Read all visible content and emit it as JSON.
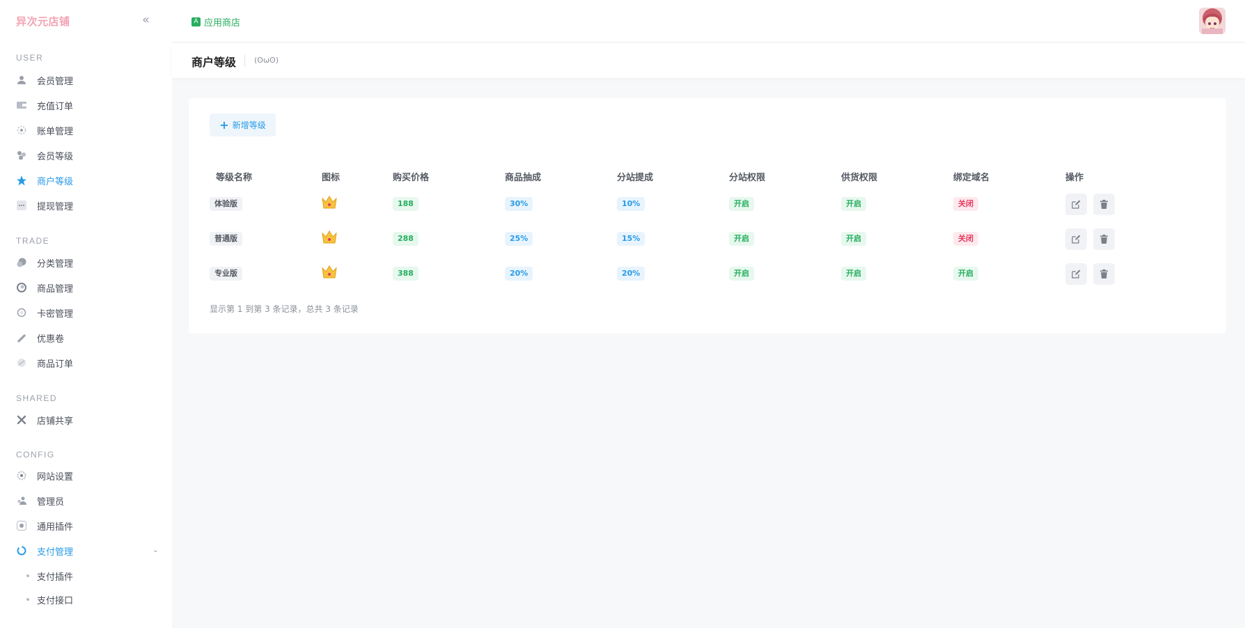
{
  "brand": "异次元店铺",
  "topbar": {
    "crumb": "应用商店"
  },
  "sidebar": {
    "sections": [
      "USER",
      "TRADE",
      "SHARED",
      "CONFIG"
    ],
    "user_items": [
      "会员管理",
      "充值订单",
      "账单管理",
      "会员等级",
      "商户等级",
      "提现管理"
    ],
    "trade_items": [
      "分类管理",
      "商品管理",
      "卡密管理",
      "优惠卷",
      "商品订单"
    ],
    "shared_items": [
      "店铺共享"
    ],
    "config_items": [
      "网站设置",
      "管理员",
      "通用插件",
      "支付管理"
    ],
    "pay_sub_items": [
      "支付插件",
      "支付接口"
    ],
    "active_item": "商户等级"
  },
  "page": {
    "title": "商户等级",
    "face": "(ʘωʘ)"
  },
  "toolbar": {
    "add_label": "新增等级"
  },
  "table": {
    "headers": [
      "等级名称",
      "图标",
      "购买价格",
      "商品抽成",
      "分站提成",
      "分站权限",
      "供货权限",
      "绑定域名",
      "操作"
    ],
    "rows": [
      {
        "name": "体验版",
        "price": "188",
        "commission": "30%",
        "substation": "10%",
        "sub_perm": "开启",
        "supply_perm": "开启",
        "domain_perm": "关闭"
      },
      {
        "name": "普通版",
        "price": "288",
        "commission": "25%",
        "substation": "15%",
        "sub_perm": "开启",
        "supply_perm": "开启",
        "domain_perm": "关闭"
      },
      {
        "name": "专业版",
        "price": "388",
        "commission": "20%",
        "substation": "20%",
        "sub_perm": "开启",
        "supply_perm": "开启",
        "domain_perm": "开启"
      }
    ],
    "summary": "显示第 1 到第 3 条记录，总共 3 条记录"
  },
  "colors": {
    "accent": "#2a9be6",
    "success": "#27ae60",
    "danger": "#e8385e",
    "brand": "#f2a3b3"
  }
}
